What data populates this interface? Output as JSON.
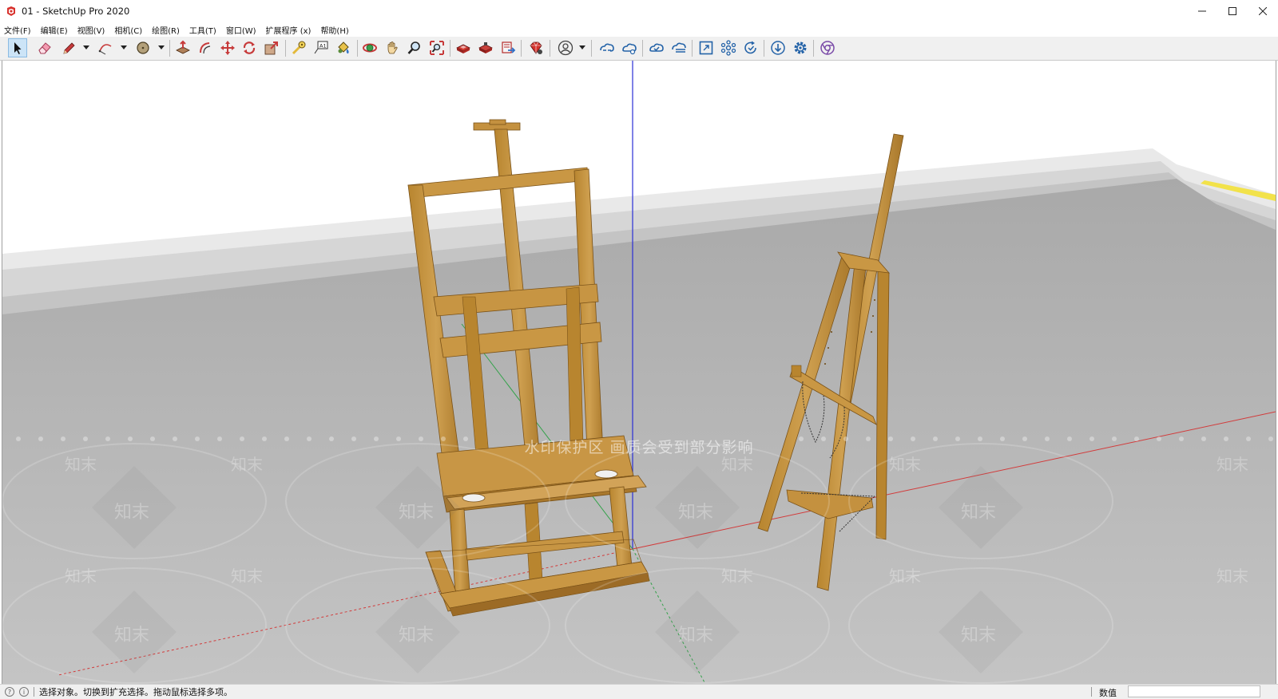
{
  "window": {
    "title": "01 - SketchUp Pro 2020",
    "controls": [
      "minimize",
      "maximize",
      "close"
    ]
  },
  "menu": {
    "items": [
      "文件(F)",
      "编辑(E)",
      "视图(V)",
      "相机(C)",
      "绘图(R)",
      "工具(T)",
      "窗口(W)",
      "扩展程序 (x)",
      "帮助(H)"
    ]
  },
  "toolbar": {
    "tools": [
      {
        "name": "select",
        "icon": "arrow-cursor-icon",
        "active": true
      },
      {
        "name": "eraser",
        "icon": "eraser-icon"
      },
      {
        "name": "line",
        "icon": "pencil-icon",
        "dropdown": true
      },
      {
        "name": "arc",
        "icon": "arc-icon",
        "dropdown": true
      },
      {
        "name": "shapes",
        "icon": "circle-icon",
        "dropdown": true
      },
      {
        "name": "push-pull",
        "icon": "push-pull-icon"
      },
      {
        "name": "offset",
        "icon": "offset-icon"
      },
      {
        "name": "move",
        "icon": "move-icon"
      },
      {
        "name": "rotate",
        "icon": "rotate-icon"
      },
      {
        "name": "scale",
        "icon": "scale-icon"
      },
      {
        "name": "tape-measure",
        "icon": "tape-measure-icon"
      },
      {
        "name": "text",
        "icon": "text-icon"
      },
      {
        "name": "paint-bucket",
        "icon": "paint-bucket-icon"
      },
      {
        "name": "orbit",
        "icon": "orbit-icon"
      },
      {
        "name": "pan",
        "icon": "pan-hand-icon"
      },
      {
        "name": "zoom",
        "icon": "zoom-icon"
      },
      {
        "name": "zoom-extents",
        "icon": "zoom-extents-icon"
      },
      {
        "name": "3d-warehouse",
        "icon": "warehouse-icon"
      },
      {
        "name": "extension-warehouse",
        "icon": "extension-warehouse-icon"
      },
      {
        "name": "send-to-layout",
        "icon": "layout-icon"
      },
      {
        "name": "extension-manager",
        "icon": "ruby-gem-icon"
      },
      {
        "name": "account",
        "icon": "user-account-icon",
        "dropdown": true
      },
      {
        "name": "trimble-connect",
        "icon": "cloud-link-icon"
      },
      {
        "name": "collaborate",
        "icon": "cloud-share-icon"
      },
      {
        "name": "cloud-sync",
        "icon": "cloud-sync-icon"
      },
      {
        "name": "cloud-publish",
        "icon": "cloud-publish-icon"
      },
      {
        "name": "model-info",
        "icon": "frame-icon"
      },
      {
        "name": "components",
        "icon": "molecule-icon"
      },
      {
        "name": "refresh-check",
        "icon": "refresh-check-icon"
      },
      {
        "name": "download",
        "icon": "download-icon"
      },
      {
        "name": "settings",
        "icon": "gear-icon"
      },
      {
        "name": "browser",
        "icon": "chrome-icon"
      }
    ]
  },
  "viewport": {
    "watermark_banner": "水印保护区   画质会受到部分影响",
    "watermark_logo": "知末"
  },
  "status": {
    "hint": "选择对象。切换到扩充选择。拖动鼠标选择多项。",
    "measurements_label": "数值",
    "measurements_value": ""
  },
  "colors": {
    "wood": "#c4913f",
    "wood_dark": "#9c6b26",
    "ground": "#b8b8b8",
    "sky": "#ffffff",
    "axis_red": "#d23b3b",
    "axis_green": "#33a24a",
    "axis_blue": "#2a2fd6"
  }
}
